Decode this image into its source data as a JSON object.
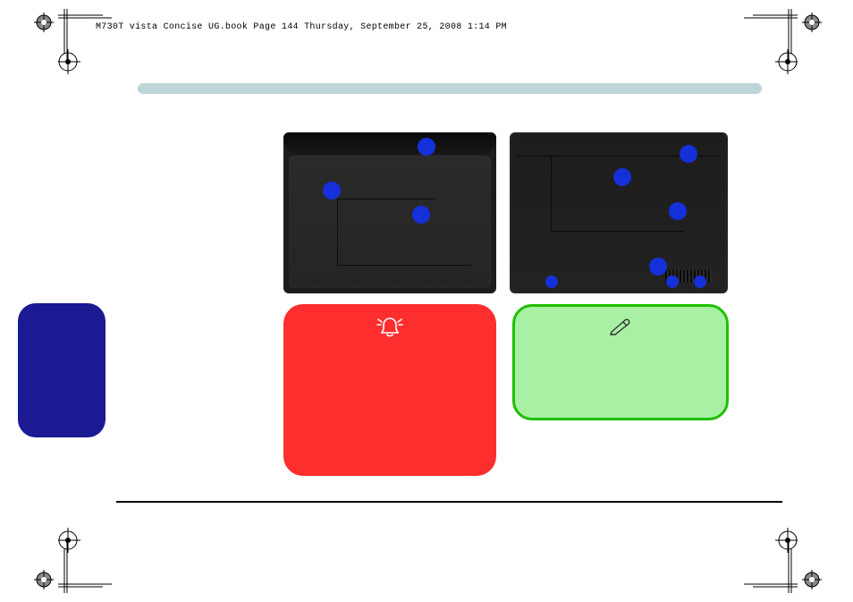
{
  "header": {
    "text": "M730T vista Concise UG.book  Page 144  Thursday, September 25, 2008  1:14 PM"
  },
  "icons": {
    "warning": "alarm-bell-icon",
    "note": "pen-icon"
  }
}
